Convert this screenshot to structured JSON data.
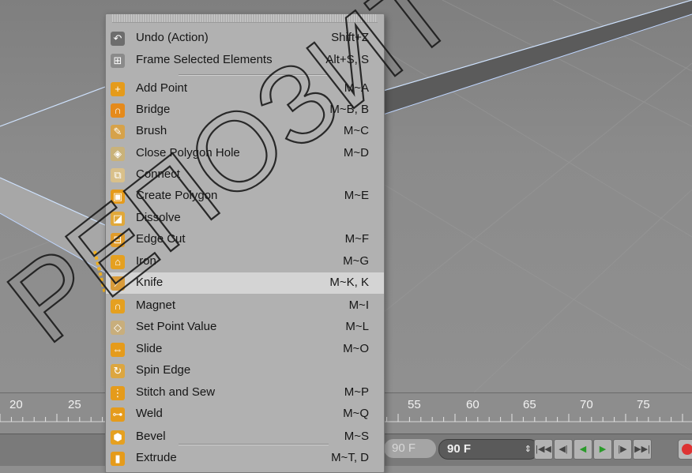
{
  "menu": {
    "items": [
      {
        "label": "Undo (Action)",
        "shortcut": "Shift+Z",
        "icon": "undo-icon",
        "color": "#6d6d6d",
        "glyph": "↶"
      },
      {
        "label": "Frame Selected Elements",
        "shortcut": "Alt+S, S",
        "icon": "frame-selected-icon",
        "color": "#8a8a8a",
        "glyph": "⊞"
      },
      {
        "label": "Add Point",
        "shortcut": "M~A",
        "icon": "add-point-icon",
        "color": "#e59b1b",
        "glyph": "+"
      },
      {
        "label": "Bridge",
        "shortcut": "M~B, B",
        "icon": "bridge-icon",
        "color": "#e58a1b",
        "glyph": "∩"
      },
      {
        "label": "Brush",
        "shortcut": "M~C",
        "icon": "brush-icon",
        "color": "#d6a24a",
        "glyph": "✎"
      },
      {
        "label": "Close Polygon Hole",
        "shortcut": "M~D",
        "icon": "close-polygon-hole-icon",
        "color": "#c9b27a",
        "glyph": "◈"
      },
      {
        "label": "Connect",
        "shortcut": "",
        "icon": "connect-icon",
        "color": "#d9c08a",
        "glyph": "⧉"
      },
      {
        "label": "Create Polygon",
        "shortcut": "M~E",
        "icon": "create-polygon-icon",
        "color": "#e59b1b",
        "glyph": "▣"
      },
      {
        "label": "Dissolve",
        "shortcut": "",
        "icon": "dissolve-icon",
        "color": "#e0a83a",
        "glyph": "◪"
      },
      {
        "label": "Edge Cut",
        "shortcut": "M~F",
        "icon": "edge-cut-icon",
        "color": "#e09b2a",
        "glyph": "⊟"
      },
      {
        "label": "Iron",
        "shortcut": "M~G",
        "icon": "iron-icon",
        "color": "#e5a020",
        "glyph": "⌂"
      },
      {
        "label": "Knife",
        "shortcut": "M~K, K",
        "icon": "knife-icon",
        "color": "#d99b3a",
        "glyph": "⟋"
      },
      {
        "label": "Magnet",
        "shortcut": "M~I",
        "icon": "magnet-icon",
        "color": "#e5a020",
        "glyph": "∩"
      },
      {
        "label": "Set Point Value",
        "shortcut": "M~L",
        "icon": "set-point-value-icon",
        "color": "#c8ae7c",
        "glyph": "◇"
      },
      {
        "label": "Slide",
        "shortcut": "M~O",
        "icon": "slide-icon",
        "color": "#e59b1b",
        "glyph": "⇔"
      },
      {
        "label": "Spin Edge",
        "shortcut": "",
        "icon": "spin-edge-icon",
        "color": "#dca640",
        "glyph": "↻"
      },
      {
        "label": "Stitch and Sew",
        "shortcut": "M~P",
        "icon": "stitch-and-sew-icon",
        "color": "#e59b1b",
        "glyph": "⋮"
      },
      {
        "label": "Weld",
        "shortcut": "M~Q",
        "icon": "weld-icon",
        "color": "#e59b1b",
        "glyph": "⊶"
      },
      {
        "label": "Bevel",
        "shortcut": "M~S",
        "icon": "bevel-icon",
        "color": "#e5a020",
        "glyph": "⬢"
      },
      {
        "label": "Extrude",
        "shortcut": "M~T, D",
        "icon": "extrude-icon",
        "color": "#e59b1b",
        "glyph": "▮"
      }
    ],
    "selected_label": "Knife"
  },
  "timeline": {
    "ticks": [
      "20",
      "25",
      "55",
      "60",
      "65",
      "70",
      "75"
    ]
  },
  "transport": {
    "end_frame": "90 F",
    "current_frame": "90 F",
    "buttons": [
      "|◀◀",
      "◀|",
      "◀",
      "▶",
      "|▶",
      "▶▶|"
    ]
  },
  "watermark": {
    "text": "РЕПОЗИТОРИЙ"
  }
}
